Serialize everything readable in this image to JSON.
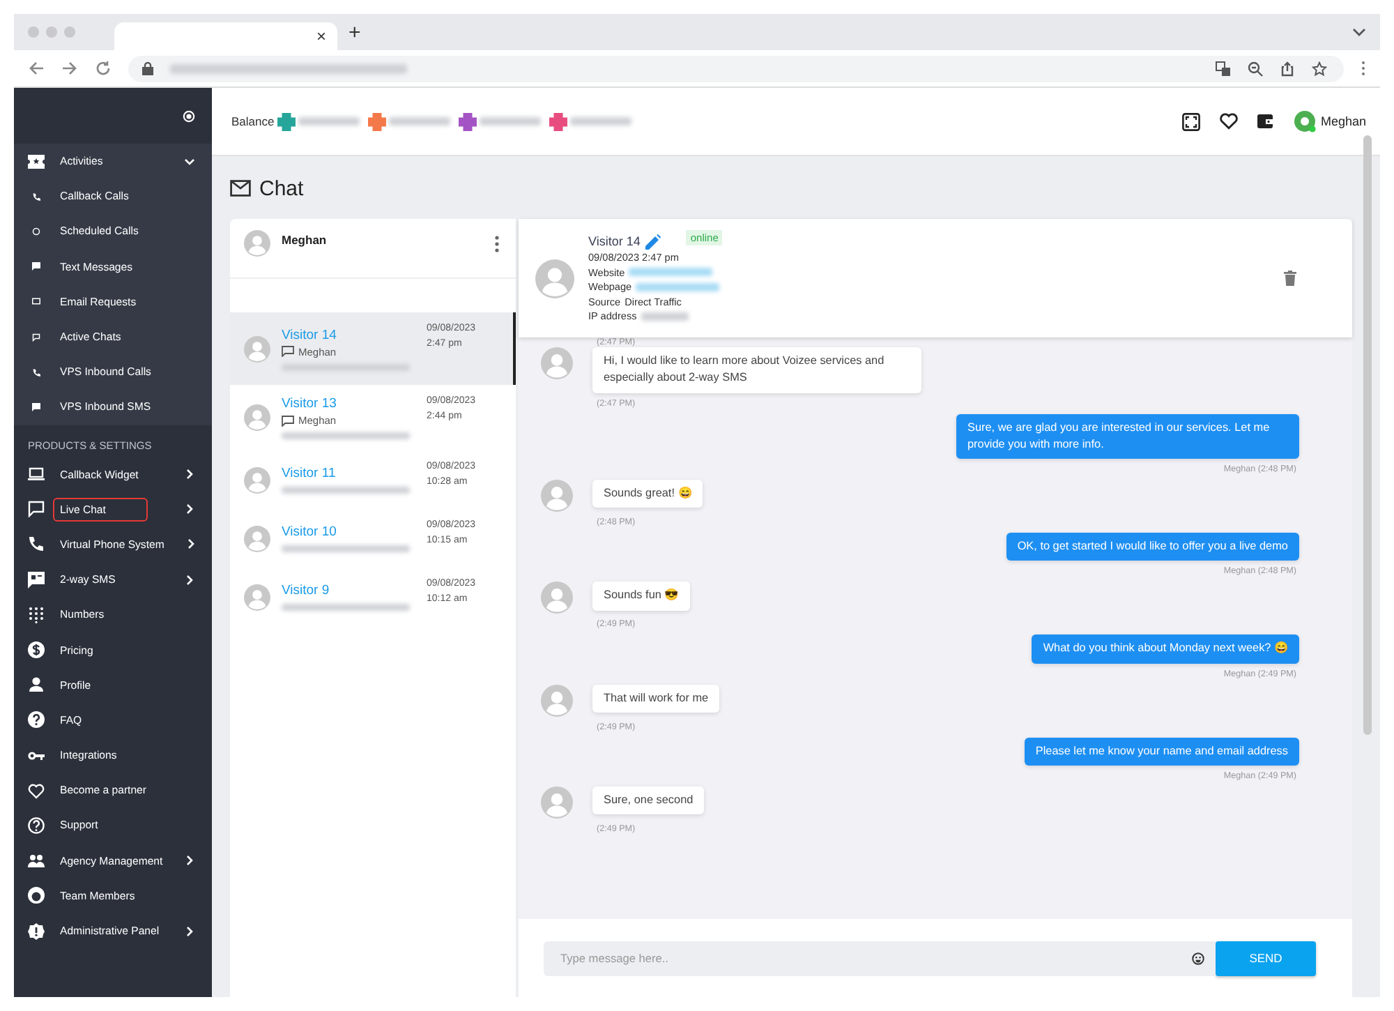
{
  "browser": {
    "tab_close": "×",
    "new_tab": "+"
  },
  "sidebar": {
    "activities": {
      "label": "Activities",
      "expanded": true,
      "children": [
        {
          "label": "Callback Calls"
        },
        {
          "label": "Scheduled Calls"
        },
        {
          "label": "Text Messages"
        },
        {
          "label": "Email Requests"
        },
        {
          "label": "Active Chats"
        },
        {
          "label": "VPS Inbound Calls"
        },
        {
          "label": "VPS Inbound SMS"
        }
      ]
    },
    "section_heading": "PRODUCTS & SETTINGS",
    "items": [
      {
        "label": "Callback Widget",
        "has_submenu": true,
        "highlighted": false
      },
      {
        "label": "Live Chat",
        "has_submenu": true,
        "highlighted": true
      },
      {
        "label": "Virtual Phone System",
        "has_submenu": true,
        "highlighted": false
      },
      {
        "label": "2-way SMS",
        "has_submenu": true,
        "highlighted": false
      },
      {
        "label": "Numbers",
        "has_submenu": false,
        "highlighted": false
      },
      {
        "label": "Pricing",
        "has_submenu": false,
        "highlighted": false
      },
      {
        "label": "Profile",
        "has_submenu": false,
        "highlighted": false
      },
      {
        "label": "FAQ",
        "has_submenu": false,
        "highlighted": false
      },
      {
        "label": "Integrations",
        "has_submenu": false,
        "highlighted": false
      },
      {
        "label": "Become a partner",
        "has_submenu": false,
        "highlighted": false
      },
      {
        "label": "Support",
        "has_submenu": false,
        "highlighted": false
      },
      {
        "label": "Agency Management",
        "has_submenu": true,
        "highlighted": false
      },
      {
        "label": "Team Members",
        "has_submenu": false,
        "highlighted": false
      },
      {
        "label": "Administrative Panel",
        "has_submenu": true,
        "highlighted": false
      }
    ]
  },
  "topbar": {
    "balance_label": "Balance",
    "balances": [
      {
        "color": "#26a69a"
      },
      {
        "color": "#f4794a"
      },
      {
        "color": "#a453c4"
      },
      {
        "color": "#e84d7f"
      }
    ],
    "user": "Meghan"
  },
  "page_title": "Chat",
  "chat_list": {
    "agent": "Meghan",
    "conversations": [
      {
        "name": "Visitor 14",
        "agent": "Meghan",
        "date": "09/08/2023",
        "time": "2:47 pm",
        "selected": true
      },
      {
        "name": "Visitor 13",
        "agent": "Meghan",
        "date": "09/08/2023",
        "time": "2:44 pm",
        "selected": false
      },
      {
        "name": "Visitor 11",
        "date": "09/08/2023",
        "time": "10:28 am",
        "selected": false
      },
      {
        "name": "Visitor 10",
        "date": "09/08/2023",
        "time": "10:15 am",
        "selected": false
      },
      {
        "name": "Visitor 9",
        "date": "09/08/2023",
        "time": "10:12 am",
        "selected": false
      }
    ]
  },
  "conversation": {
    "visitor": "Visitor 14",
    "status": "online",
    "datetime": "09/08/2023 2:47 pm",
    "details": [
      {
        "label": "Website"
      },
      {
        "label": "Webpage"
      },
      {
        "label": "Source",
        "value": "Direct Traffic"
      },
      {
        "label": "IP address"
      }
    ],
    "first_time": "(2:47 PM)",
    "messages": [
      {
        "kind": "visitor",
        "text": "Hi, I would like to learn more about Voizee services and especially about 2-way SMS",
        "time": "(2:47 PM)"
      },
      {
        "kind": "agent",
        "text": "Sure, we are glad you are interested in our services. Let me provide you with more info.",
        "sender": "Meghan",
        "time": "(2:48 PM)"
      },
      {
        "kind": "visitor",
        "text": "Sounds great! 😄",
        "time": "(2:48 PM)"
      },
      {
        "kind": "agent",
        "text": "OK, to get started I would like to offer you a live demo",
        "sender": "Meghan",
        "time": "(2:48 PM)"
      },
      {
        "kind": "visitor",
        "text": "Sounds fun 😎",
        "time": "(2:49 PM)"
      },
      {
        "kind": "agent",
        "text": "What do you think about Monday next week? 😄",
        "sender": "Meghan",
        "time": "(2:49 PM)"
      },
      {
        "kind": "visitor",
        "text": "That will work for me",
        "time": "(2:49 PM)"
      },
      {
        "kind": "agent",
        "text": "Please let me know your name and email address",
        "sender": "Meghan",
        "time": "(2:49 PM)"
      },
      {
        "kind": "visitor",
        "text": "Sure, one second",
        "time": "(2:49 PM)"
      }
    ],
    "input_placeholder": "Type message here..",
    "send": "SEND"
  }
}
